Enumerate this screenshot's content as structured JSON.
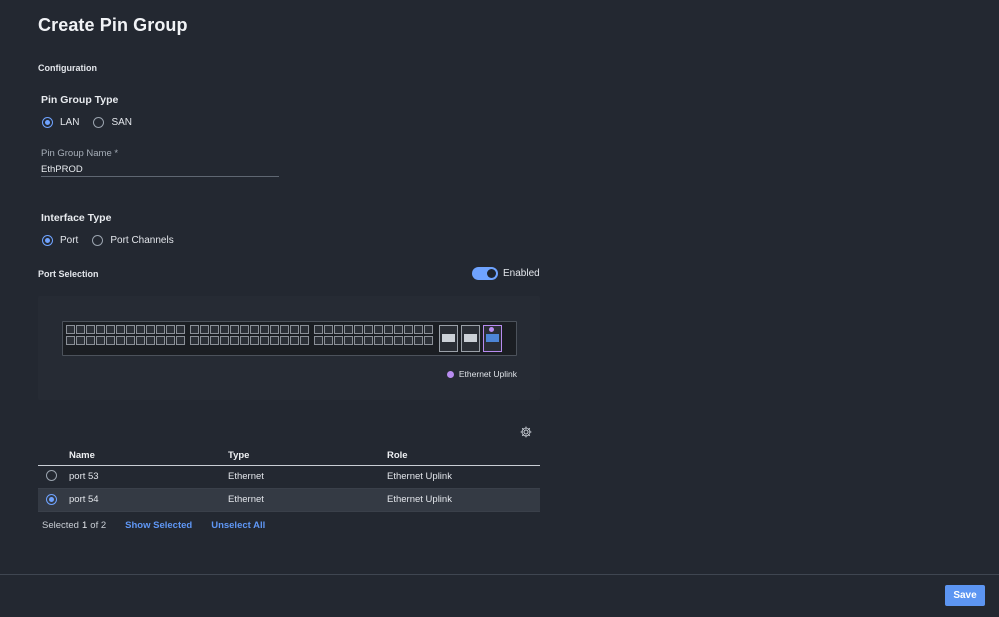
{
  "page": {
    "title": "Create Pin Group"
  },
  "configuration": {
    "label": "Configuration"
  },
  "pin_group_type": {
    "heading": "Pin Group Type",
    "options": [
      {
        "label": "LAN",
        "checked": true
      },
      {
        "label": "SAN",
        "checked": false
      }
    ]
  },
  "pin_group_name": {
    "label": "Pin Group Name *",
    "value": "EthPROD"
  },
  "interface_type": {
    "heading": "Interface Type",
    "options": [
      {
        "label": "Port",
        "checked": true
      },
      {
        "label": "Port Channels",
        "checked": false
      }
    ]
  },
  "port_selection": {
    "label": "Port Selection",
    "toggle_label": "Enabled",
    "legend": "Ethernet Uplink",
    "legend_color": "#b88cf0"
  },
  "table": {
    "columns": [
      "Name",
      "Type",
      "Role"
    ],
    "rows": [
      {
        "name": "port 53",
        "type": "Ethernet",
        "role": "Ethernet Uplink",
        "selected": false
      },
      {
        "name": "port 54",
        "type": "Ethernet",
        "role": "Ethernet Uplink",
        "selected": true
      }
    ]
  },
  "footer": {
    "selected_prefix": "Selected",
    "selected_count": "1",
    "selected_suffix": "of 2",
    "show_selected": "Show Selected",
    "unselect_all": "Unselect All"
  },
  "actions": {
    "save": "Save"
  },
  "colors": {
    "accent": "#5c95f2",
    "background": "#232831",
    "uplink": "#b88cf0"
  }
}
